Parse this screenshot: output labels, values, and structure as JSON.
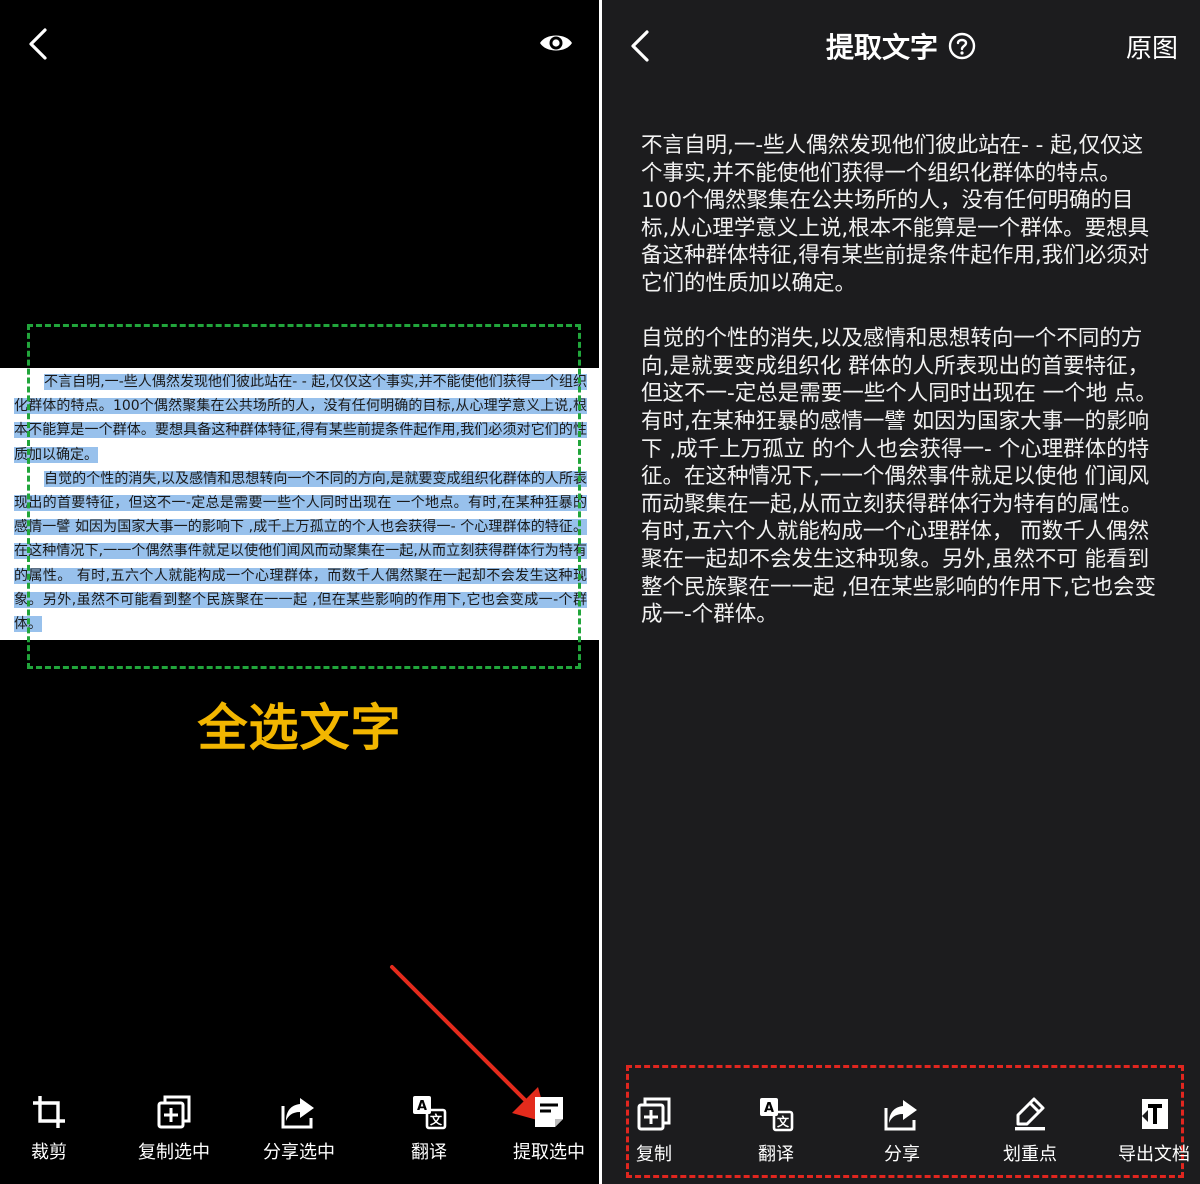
{
  "left_screen": {
    "document_paragraphs": [
      "不言自明,一-些人偶然发现他们彼此站在- - 起,仅仅这个事实,并不能使他们获得一个组织化群体的特点。100个偶然聚集在公共场所的人，没有任何明确的目标,从心理学意义上说,根本不能算是一个群体。要想具备这种群体特征,得有某些前提条件起作用,我们必须对它们的性质加以确定。",
      "自觉的个性的消失,以及感情和思想转向一个不同的方向,是就要变成组织化群体的人所表现出的首要特征，但这不一-定总是需要一些个人同时出现在 一个地点。有时,在某种狂暴的感情一譬 如因为国家大事一的影响下 ,成千上万孤立的个人也会获得一- 个心理群体的特征。在这种情况下,一一个偶然事件就足以使他们闻风而动聚集在一起,从而立刻获得群体行为特有的属性。 有时,五六个人就能构成一个心理群体，而数千人偶然聚在一起却不会发生这种现象。另外,虽然不可能看到整个民族聚在一一起 ,但在某些影响的作用下,它也会变成一-个群体。",
      "......"
    ],
    "caption": "全选文字",
    "toolbar": [
      {
        "label": "裁剪",
        "icon": "crop-icon"
      },
      {
        "label": "复制选中",
        "icon": "copy-icon"
      },
      {
        "label": "分享选中",
        "icon": "share-icon"
      },
      {
        "label": "翻译",
        "icon": "translate-icon"
      },
      {
        "label": "提取选中",
        "icon": "extract-icon"
      }
    ],
    "colors": {
      "highlight": "#98c1ec",
      "selection_border": "#21a53b",
      "caption": "#f2b600",
      "arrow": "#e32b1c"
    }
  },
  "right_screen": {
    "title": "提取文字",
    "original_button": "原图",
    "paragraphs": [
      "不言自明,一-些人偶然发现他们彼此站在- - 起,仅仅这个事实,并不能使他们获得一个组织化群体的特点。100个偶然聚集在公共场所的人，没有任何明确的目标,从心理学意义上说,根本不能算是一个群体。要想具备这种群体特征,得有某些前提条件起作用,我们必须对它们的性质加以确定。",
      "自觉的个性的消失,以及感情和思想转向一个不同的方向,是就要变成组织化 群体的人所表现出的首要特征，但这不一-定总是需要一些个人同时出现在 一个地 点。有时,在某种狂暴的感情一譬 如因为国家大事一的影响下 ,成千上万孤立 的个人也会获得一- 个心理群体的特征。在这种情况下,一一个偶然事件就足以使他 们闻风而动聚集在一起,从而立刻获得群体行为特有的属性。 有时,五六个人就能构成一个心理群体， 而数千人偶然聚在一起却不会发生这种现象。另外,虽然不可 能看到整个民族聚在一一起 ,但在某些影响的作用下,它也会变成一-个群体。"
    ],
    "toolbar": [
      {
        "label": "复制",
        "icon": "copy-icon"
      },
      {
        "label": "翻译",
        "icon": "translate-icon"
      },
      {
        "label": "分享",
        "icon": "share-icon"
      },
      {
        "label": "划重点",
        "icon": "highlighter-icon"
      },
      {
        "label": "导出文档",
        "icon": "export-doc-icon"
      }
    ],
    "colors": {
      "background": "#1c1c1e",
      "toolbar_border": "#e0261f"
    }
  }
}
